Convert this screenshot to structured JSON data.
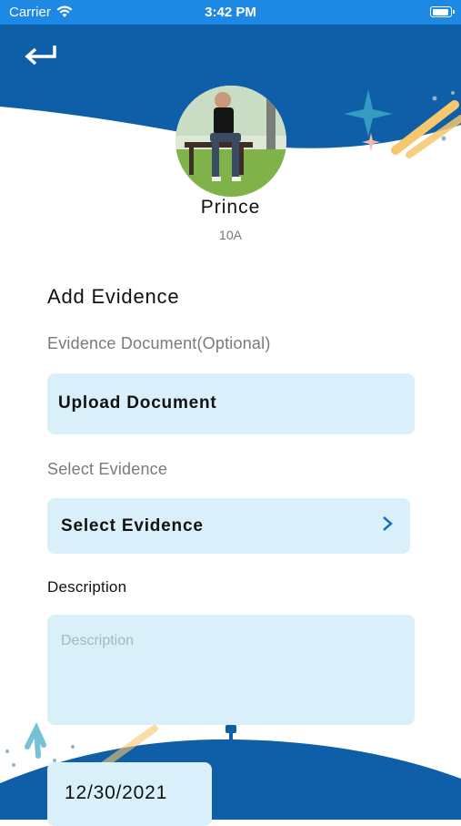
{
  "status_bar": {
    "carrier": "Carrier",
    "time": "3:42 PM",
    "battery_level": 0.95
  },
  "profile": {
    "name": "Prince",
    "class": "10A"
  },
  "form": {
    "title": "Add Evidence",
    "document_label": "Evidence Document(Optional)",
    "upload_button": "Upload Document",
    "select_label": "Select Evidence",
    "select_value": "Select Evidence",
    "description_label": "Description",
    "description_placeholder": "Description",
    "date": "12/30/2021"
  },
  "colors": {
    "primary": "#0f5ea8",
    "status_bar": "#1e88e5",
    "field_bg": "#d9f0fa"
  }
}
